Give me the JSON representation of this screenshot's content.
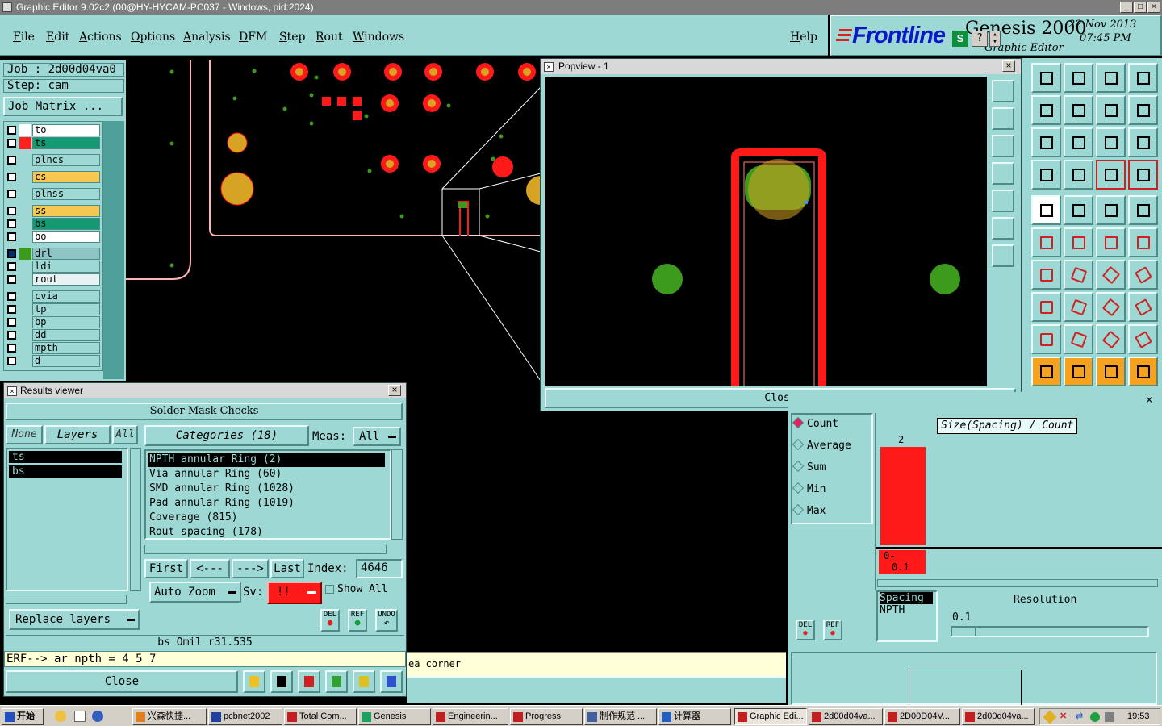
{
  "window": {
    "title": "Graphic Editor 9.02c2 (00@HY-HYCAM-PC037 - Windows, pid:2024)"
  },
  "menu": [
    "File",
    "Edit",
    "Actions",
    "Options",
    "Analysis",
    "DFM",
    "Step",
    "Rout",
    "Windows"
  ],
  "help": "Help",
  "logo": {
    "brand": "Frontline",
    "product": "Genesis 2000",
    "sub": "Graphic Editor",
    "date": "22 Nov 2013",
    "time": "07:45 PM"
  },
  "job": {
    "job_line": "Job : 2d00d04va0",
    "step_line": "Step: cam",
    "matrix_button": "Job Matrix ..."
  },
  "layers": [
    {
      "name": "to",
      "swatch": "#ffffff",
      "bg": "#ffffff"
    },
    {
      "name": "ts",
      "swatch": "#ff2020",
      "bg": "#139a73"
    },
    {
      "name": "plncs",
      "swatch": "#9ed8d4",
      "bg": "#9ed8d4"
    },
    {
      "name": "cs",
      "swatch": "#9ed8d4",
      "bg": "#f7c850"
    },
    {
      "name": "plnss",
      "swatch": "#9ed8d4",
      "bg": "#9ed8d4"
    },
    {
      "name": "ss",
      "swatch": "#9ed8d4",
      "bg": "#f7c850"
    },
    {
      "name": "bs",
      "swatch": "#9ed8d4",
      "bg": "#139a73"
    },
    {
      "name": "bo",
      "swatch": "#9ed8d4",
      "bg": "#ffffff"
    },
    {
      "name": "drl",
      "swatch": "#3c9a1c",
      "bg": "#8ec4c4"
    },
    {
      "name": "ldi",
      "swatch": "#9ed8d4",
      "bg": "#9ed8d4"
    },
    {
      "name": "rout",
      "swatch": "#9ed8d4",
      "bg": "#e8f2f2"
    },
    {
      "name": "cvia",
      "swatch": "#9ed8d4",
      "bg": "#9ed8d4"
    },
    {
      "name": "tp",
      "swatch": "#9ed8d4",
      "bg": "#9ed8d4"
    },
    {
      "name": "bp",
      "swatch": "#9ed8d4",
      "bg": "#9ed8d4"
    },
    {
      "name": "dd",
      "swatch": "#9ed8d4",
      "bg": "#9ed8d4"
    },
    {
      "name": "mpth",
      "swatch": "#9ed8d4",
      "bg": "#9ed8d4"
    },
    {
      "name": "d",
      "swatch": "#9ed8d4",
      "bg": "#9ed8d4"
    }
  ],
  "popview": {
    "title": "Popview - 1",
    "close": "Close"
  },
  "results": {
    "title": "Results viewer",
    "header": "Solder Mask Checks",
    "none_btn": "None",
    "layers_btn": "Layers",
    "all_btn": "All",
    "categories_btn": "Categories (18)",
    "meas_label": "Meas:",
    "meas_value": "All",
    "layer_list": [
      "ts",
      "bs"
    ],
    "categories": [
      "NPTH annular Ring (2)",
      "Via annular Ring (60)",
      "SMD annular Ring (1028)",
      "Pad annular Ring (1019)",
      "Coverage (815)",
      "Rout spacing (178)"
    ],
    "first": "First",
    "prev": "<---",
    "next": "--->",
    "last": "Last",
    "index_label": "Index:",
    "index_value": "4646",
    "auto_zoom": "Auto Zoom",
    "sv_label": "Sv:",
    "sv_value": "!!",
    "show_all": "Show All",
    "replace_layers": "Replace layers",
    "status_line": "bs Omil   r31.535",
    "erf_line": "ERF--> ar_npth = 4 5 7",
    "close": "Close",
    "icon_labels": {
      "del": "DEL",
      "ref": "REF",
      "undo": "UNDO"
    }
  },
  "canvas_status": "ea corner",
  "stats": {
    "radios": [
      "Count",
      "Average",
      "Sum",
      "Min",
      "Max"
    ],
    "selected": "Count",
    "graph_title": "Size(Spacing) / Count",
    "bar_value": "2",
    "bar_label_top": "0-",
    "bar_label_bottom": "0.1",
    "spacing_header": "Spacing",
    "spacing_value": "NPTH",
    "resolution_label": "Resolution",
    "resolution_value": "0.1",
    "del": "DEL",
    "ref": "REF"
  },
  "taskbar": {
    "start": "开始",
    "tasks": [
      "兴森快捷...",
      "pcbnet2002",
      "Total Com...",
      "Genesis",
      "Engineerin...",
      "Progress",
      "制作规范 ...",
      "计算器",
      "Graphic Edi...",
      "2d00d04va...",
      "2D00D04V...",
      "2d00d04va..."
    ],
    "clock": "19:53"
  },
  "colors": {
    "panel": "#9ed8d4",
    "red": "#ff1a1a",
    "green": "#3c9a1c",
    "gold": "#d7a322"
  }
}
